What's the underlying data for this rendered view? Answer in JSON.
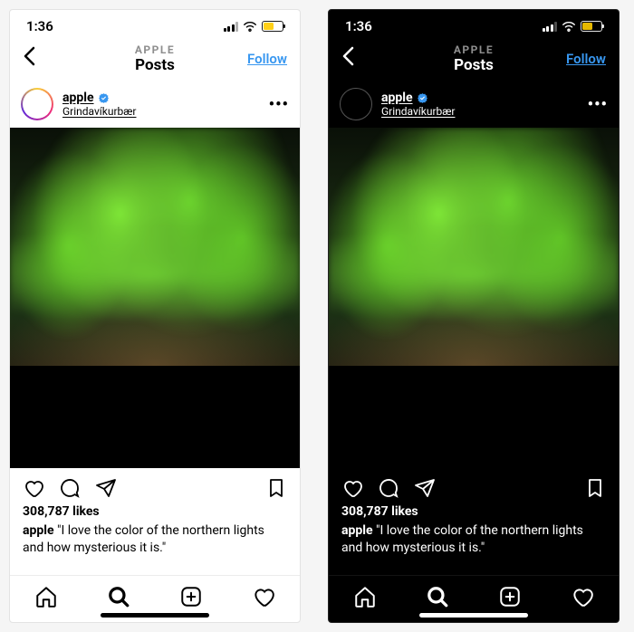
{
  "status": {
    "time": "1:36"
  },
  "header": {
    "subtitle": "APPLE",
    "title": "Posts",
    "follow_label": "Follow"
  },
  "post": {
    "username": "apple",
    "location": "Grindavíkurbær",
    "likes_count": "308,787 likes",
    "caption_user": "apple",
    "caption_text": "\"I love the color of the northern lights and how mysterious it is.\"",
    "avatar_glyph": ""
  },
  "colors": {
    "accent": "#3897f0",
    "verified": "#3897f0"
  }
}
